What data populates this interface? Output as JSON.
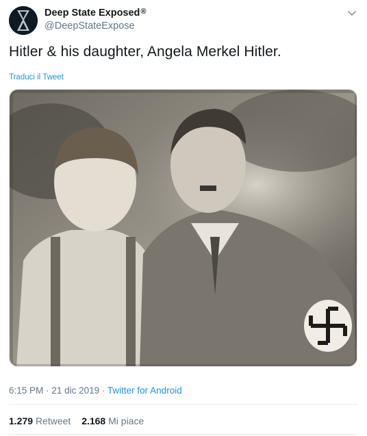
{
  "author": {
    "display_name": "Deep State Exposed",
    "verified_mark": "®",
    "handle": "@DeepStateExpose",
    "avatar_icon": "hourglass-silhouette-avatar"
  },
  "tweet": {
    "text": "Hitler & his daughter, Angela Merkel Hitler.",
    "translate_label": "Traduci il Tweet",
    "media_description_icon": "sepia-photo"
  },
  "meta": {
    "time": "6:15 PM",
    "separator1": "·",
    "date": "21 dic 2019",
    "separator2": "·",
    "source": "Twitter for Android"
  },
  "stats": {
    "retweets_count": "1.279",
    "retweets_label": "Retweet",
    "likes_count": "2.168",
    "likes_label": "Mi piace"
  },
  "colors": {
    "link": "#1b95e0",
    "secondary_text": "#657786",
    "primary_text": "#14171a",
    "divider": "#e6ecf0"
  }
}
